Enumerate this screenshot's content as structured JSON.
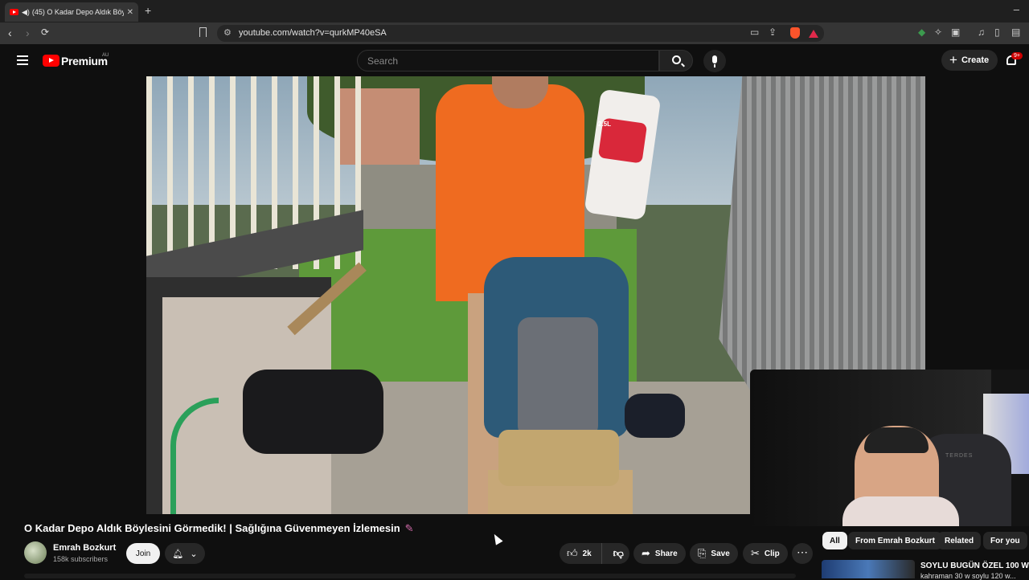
{
  "browser": {
    "tab_title": "(45) O Kadar Depo Aldık Böyl...",
    "url": "youtube.com/watch?v=qurkMP40eSA"
  },
  "header": {
    "logo_text": "Premium",
    "logo_region": "AU",
    "search_placeholder": "Search",
    "create_label": "Create",
    "notification_badge": "9+"
  },
  "video": {
    "title": "O Kadar Depo Aldık Böylesini Görmedik! | Sağlığına Güvenmeyen İzlemesin",
    "bag_label": "2.5L",
    "webcam_chair_label": "TERDES"
  },
  "channel": {
    "name": "Emrah Bozkurt",
    "subscribers": "158k subscribers",
    "join_label": "Join"
  },
  "actions": {
    "likes": "2k",
    "share": "Share",
    "save": "Save",
    "clip": "Clip"
  },
  "chips": [
    "All",
    "From Emrah Bozkurt",
    "Related",
    "For you"
  ],
  "recommendation": {
    "title": "SOYLU BUGÜN ÖZEL 100 W",
    "subtitle": "kahraman 30 w soylu 120 w..."
  },
  "colors": {
    "accent": "#ff0000",
    "background": "#0f0f0f",
    "pill": "#272727"
  }
}
